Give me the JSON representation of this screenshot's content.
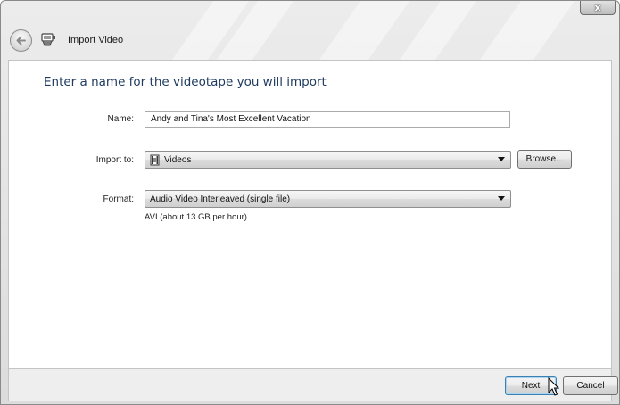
{
  "window": {
    "title": "Import Video",
    "close_glyph": "x",
    "icons": {
      "back": "back-arrow-icon",
      "app": "video-camera-icon",
      "close": "close-icon"
    }
  },
  "main": {
    "heading": "Enter a name for the videotape you will import",
    "name": {
      "label": "Name:",
      "value": "Andy and Tina's Most Excellent Vacation"
    },
    "import_to": {
      "label": "Import to:",
      "value": "Videos",
      "icon": "videos-folder-icon",
      "browse_label": "Browse..."
    },
    "format": {
      "label": "Format:",
      "value": "Audio Video Interleaved (single file)",
      "description": "AVI (about 13 GB per hour)"
    }
  },
  "footer": {
    "next_label": "Next",
    "cancel_label": "Cancel"
  },
  "colors": {
    "heading": "#1e3a5f",
    "default_button_border": "#3c7fb1"
  }
}
